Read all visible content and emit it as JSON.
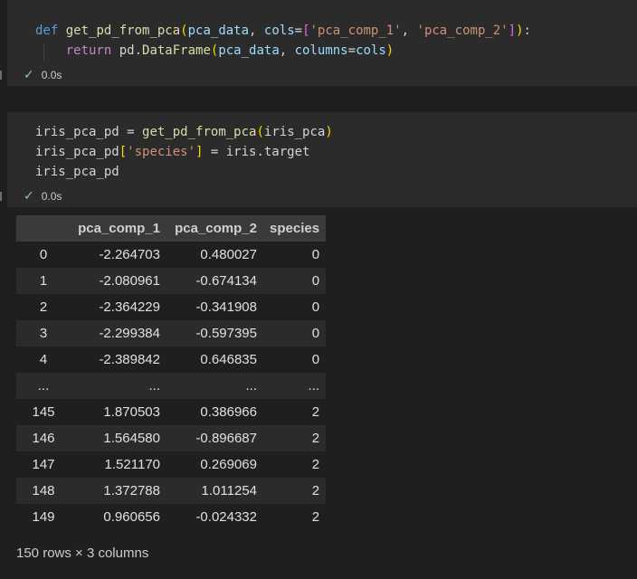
{
  "cell1": {
    "code": {
      "line1": {
        "def": "def",
        "fname": "get_pd_from_pca",
        "open": "(",
        "p1": "pca_data",
        "comma1": ", ",
        "p2": "cols",
        "eq": "=",
        "lbr": "[",
        "s1": "'pca_comp_1'",
        "comma2": ", ",
        "s2": "'pca_comp_2'",
        "rbr": "]",
        "close": ")",
        "colon": ":"
      },
      "line2": {
        "ret": "return",
        "obj": " pd.",
        "fn": "DataFrame",
        "open": "(",
        "a1": "pca_data",
        "comma": ", ",
        "kw": "columns",
        "eq": "=",
        "a2": "cols",
        "close": ")"
      }
    },
    "status": {
      "time": "0.0s"
    }
  },
  "cell2": {
    "code": {
      "line1": {
        "lhs": "iris_pca_pd ",
        "eq": "=",
        "sp": " ",
        "fn": "get_pd_from_pca",
        "open": "(",
        "arg": "iris_pca",
        "close": ")"
      },
      "line2": {
        "lhs": "iris_pca_pd",
        "lbr": "[",
        "str": "'species'",
        "rbr": "]",
        "rest": " = iris.target"
      },
      "line3": {
        "text": "iris_pca_pd"
      }
    },
    "status": {
      "time": "0.0s"
    }
  },
  "icons": {
    "check": "check-icon"
  },
  "table": {
    "columns": [
      "",
      "pca_comp_1",
      "pca_comp_2",
      "species"
    ],
    "rows": [
      [
        "0",
        "-2.264703",
        "0.480027",
        "0"
      ],
      [
        "1",
        "-2.080961",
        "-0.674134",
        "0"
      ],
      [
        "2",
        "-2.364229",
        "-0.341908",
        "0"
      ],
      [
        "3",
        "-2.299384",
        "-0.597395",
        "0"
      ],
      [
        "4",
        "-2.389842",
        "0.646835",
        "0"
      ],
      [
        "...",
        "...",
        "...",
        "..."
      ],
      [
        "145",
        "1.870503",
        "0.386966",
        "2"
      ],
      [
        "146",
        "1.564580",
        "-0.896687",
        "2"
      ],
      [
        "147",
        "1.521170",
        "0.269069",
        "2"
      ],
      [
        "148",
        "1.372788",
        "1.011254",
        "2"
      ],
      [
        "149",
        "0.960656",
        "-0.024332",
        "2"
      ]
    ]
  },
  "footer": {
    "text": "150 rows × 3 columns"
  },
  "colors": {
    "background": "#1f1f1f",
    "cell_background": "#2b2b2b",
    "success_check": "#89d185",
    "keyword": "#c586c0",
    "function": "#dcdcaa",
    "string": "#ce9178",
    "param": "#9cdcfe"
  }
}
